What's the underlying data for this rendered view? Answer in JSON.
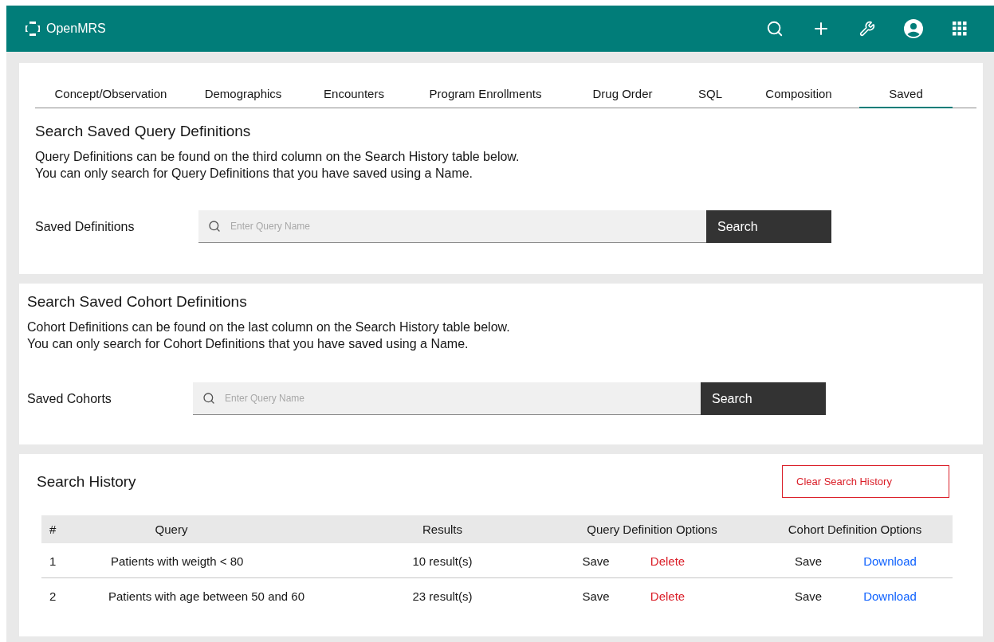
{
  "header": {
    "brand": "OpenMRS"
  },
  "tabs": [
    {
      "label": "Concept/Observation",
      "selected": false
    },
    {
      "label": "Demographics",
      "selected": false
    },
    {
      "label": "Encounters",
      "selected": false
    },
    {
      "label": "Program Enrollments",
      "selected": false
    },
    {
      "label": "Drug Order",
      "selected": false
    },
    {
      "label": "SQL",
      "selected": false
    },
    {
      "label": "Composition",
      "selected": false
    },
    {
      "label": "Saved",
      "selected": true
    }
  ],
  "saved_query": {
    "title": "Search Saved Query Definitions",
    "description": [
      "Query Definitions can be found on the third column on the Search History table below.",
      "You can only search for Query Definitions that you have saved using a Name."
    ],
    "field_label": "Saved Definitions",
    "placeholder": "Enter Query Name",
    "button": "Search"
  },
  "saved_cohort": {
    "title": "Search Saved Cohort Definitions",
    "description": [
      "Cohort Definitions can be found on the last column on the Search History table below.",
      "You can only search for Cohort Definitions that you have saved using a Name."
    ],
    "field_label": "Saved Cohorts",
    "placeholder": "Enter Query Name",
    "button": "Search"
  },
  "history": {
    "title": "Search History",
    "clear_button": "Clear Search History",
    "columns": [
      "#",
      "Query",
      "Results",
      "Query Definition Options",
      "Cohort Definition Options"
    ],
    "rows": [
      {
        "number": "1",
        "query": "Patients with weigth < 80",
        "results": "10 result(s)",
        "query_actions": [
          {
            "label": "Save",
            "kind": "plain"
          },
          {
            "label": "Delete",
            "kind": "danger"
          }
        ],
        "cohort_actions": [
          {
            "label": "Save",
            "kind": "plain"
          },
          {
            "label": "Download",
            "kind": "link"
          }
        ]
      },
      {
        "number": "2",
        "query": "Patients with age between 50 and 60",
        "results": "23 result(s)",
        "query_actions": [
          {
            "label": "Save",
            "kind": "plain"
          },
          {
            "label": "Delete",
            "kind": "danger"
          }
        ],
        "cohort_actions": [
          {
            "label": "Save",
            "kind": "plain"
          },
          {
            "label": "Download",
            "kind": "link"
          }
        ]
      }
    ]
  }
}
